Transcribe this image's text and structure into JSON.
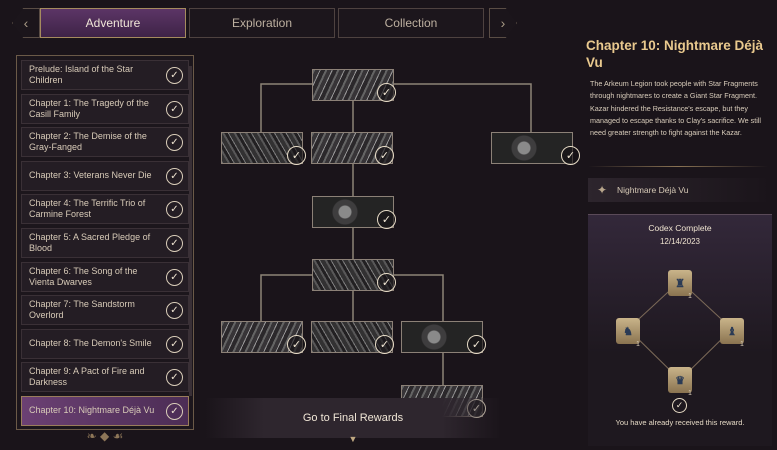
{
  "tabs": [
    {
      "label": "Adventure",
      "active": true
    },
    {
      "label": "Exploration",
      "active": false
    },
    {
      "label": "Collection",
      "active": false
    }
  ],
  "nav": {
    "prev_icon": "‹",
    "next_icon": "›"
  },
  "chapters": [
    {
      "label": "Prelude: Island of the Star Children",
      "completed": true
    },
    {
      "label": "Chapter 1: The Tragedy of the Casill Family",
      "completed": true
    },
    {
      "label": "Chapter 2: The Demise of the Gray-Fanged",
      "completed": true
    },
    {
      "label": "Chapter 3: Veterans Never Die",
      "completed": true
    },
    {
      "label": "Chapter 4: The Terrific Trio of Carmine Forest",
      "completed": true
    },
    {
      "label": "Chapter 5: A Sacred Pledge of Blood",
      "completed": true
    },
    {
      "label": "Chapter 6: The Song of the Vienta Dwarves",
      "completed": true
    },
    {
      "label": "Chapter 7: The Sandstorm Overlord",
      "completed": true
    },
    {
      "label": "Chapter 8: The Demon's Smile",
      "completed": true
    },
    {
      "label": "Chapter 9: A Pact of Fire and Darkness",
      "completed": true
    },
    {
      "label": "Chapter 10: Nightmare Déjà Vu",
      "completed": true,
      "active": true
    }
  ],
  "check_glyph": "✓",
  "final_rewards": {
    "label": "Go to Final Rewards"
  },
  "detail": {
    "title": "Chapter 10: Nightmare Déjà Vu",
    "description": "The Arkeum Legion took people with Star Fragments through nightmares to create a Giant Star Fragment. Kazar hindered the Resistance's escape, but they managed to escape thanks to Clay's sacrifice. We still need greater strength to fight against the Kazar.",
    "codex_name": "Nightmare Déjà Vu",
    "codex_icon": "compass-icon",
    "codex_status": "Codex Complete",
    "codex_date": "12/14/2023",
    "reward_count": "1",
    "received_text": "You have already received this reward."
  },
  "colors": {
    "accent_purple": "#5c3566",
    "gold": "#e9c98e",
    "panel_bg": "#1c161c"
  }
}
